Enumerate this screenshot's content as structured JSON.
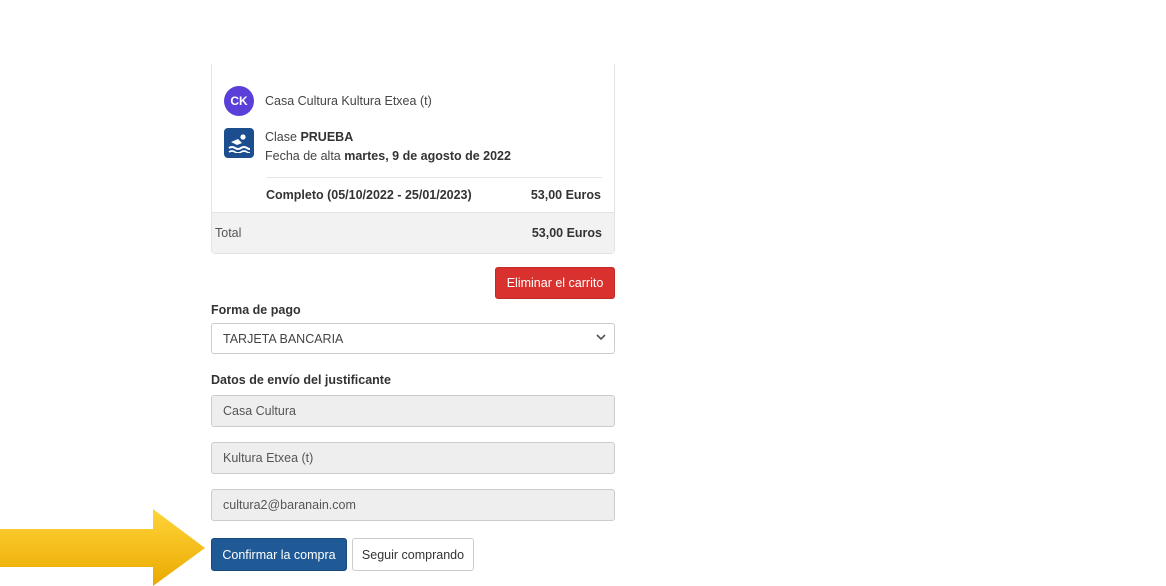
{
  "cart": {
    "org": {
      "initials": "CK",
      "name": "Casa Cultura Kultura Etxea (t)"
    },
    "item": {
      "class_prefix": "Clase ",
      "class_name": "PRUEBA",
      "date_prefix": "Fecha de alta ",
      "date_value": "martes, 9 de agosto de 2022",
      "period": "Completo (05/10/2022 - 25/01/2023)",
      "price": "53,00 Euros"
    },
    "total_label": "Total",
    "total_value": "53,00 Euros",
    "delete_label": "Eliminar el carrito"
  },
  "payment": {
    "label": "Forma de pago",
    "selected": "TARJETA BANCARIA"
  },
  "shipping": {
    "label": "Datos de envío del justificante",
    "first_name": "Casa Cultura",
    "last_name": "Kultura Etxea (t)",
    "email": "cultura2@baranain.com"
  },
  "actions": {
    "confirm_label": "Confirmar la compra",
    "continue_label": "Seguir comprando"
  },
  "colors": {
    "accent": "#1f5a96",
    "danger": "#d9322e",
    "avatar": "#5b3fd8",
    "arrow": "#f2b600"
  },
  "icons": {
    "class_icon": "swimming-icon",
    "select_chevron": "chevron-down-icon",
    "pointer": "arrow-right-icon"
  }
}
